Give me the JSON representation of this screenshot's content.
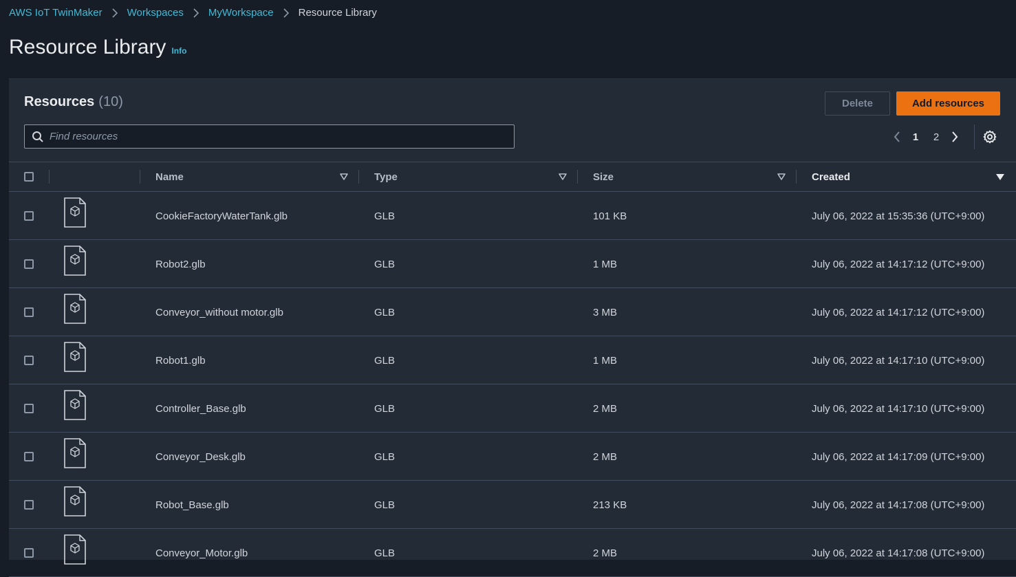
{
  "breadcrumb": {
    "items": [
      "AWS IoT TwinMaker",
      "Workspaces",
      "MyWorkspace"
    ],
    "current": "Resource Library"
  },
  "page": {
    "title": "Resource Library",
    "info": "Info"
  },
  "resources": {
    "title": "Resources",
    "count": "(10)",
    "delete_label": "Delete",
    "add_label": "Add resources",
    "search_placeholder": "Find resources",
    "pages": [
      "1",
      "2"
    ],
    "current_page": "1"
  },
  "table": {
    "columns": {
      "name": "Name",
      "type": "Type",
      "size": "Size",
      "created": "Created"
    },
    "sorted_column": "created",
    "rows": [
      {
        "name": "CookieFactoryWaterTank.glb",
        "type": "GLB",
        "size": "101 KB",
        "created": "July 06, 2022 at 15:35:36 (UTC+9:00)"
      },
      {
        "name": "Robot2.glb",
        "type": "GLB",
        "size": "1 MB",
        "created": "July 06, 2022 at 14:17:12 (UTC+9:00)"
      },
      {
        "name": "Conveyor_without motor.glb",
        "type": "GLB",
        "size": "3 MB",
        "created": "July 06, 2022 at 14:17:12 (UTC+9:00)"
      },
      {
        "name": "Robot1.glb",
        "type": "GLB",
        "size": "1 MB",
        "created": "July 06, 2022 at 14:17:10 (UTC+9:00)"
      },
      {
        "name": "Controller_Base.glb",
        "type": "GLB",
        "size": "2 MB",
        "created": "July 06, 2022 at 14:17:10 (UTC+9:00)"
      },
      {
        "name": "Conveyor_Desk.glb",
        "type": "GLB",
        "size": "2 MB",
        "created": "July 06, 2022 at 14:17:09 (UTC+9:00)"
      },
      {
        "name": "Robot_Base.glb",
        "type": "GLB",
        "size": "213 KB",
        "created": "July 06, 2022 at 14:17:08 (UTC+9:00)"
      },
      {
        "name": "Conveyor_Motor.glb",
        "type": "GLB",
        "size": "2 MB",
        "created": "July 06, 2022 at 14:17:08 (UTC+9:00)"
      }
    ]
  },
  "icons": {
    "breadcrumb_separator": "chevron-right-icon",
    "search": "search-icon",
    "prev": "chevron-left-icon",
    "next": "chevron-right-icon",
    "settings": "gear-icon",
    "file": "3d-model-file-icon",
    "sort": "caret-down-icon"
  },
  "colors": {
    "background": "#161d26",
    "panel": "#232b37",
    "link": "#44b9d6",
    "primary_button": "#ec7211",
    "border": "#414d5c"
  }
}
